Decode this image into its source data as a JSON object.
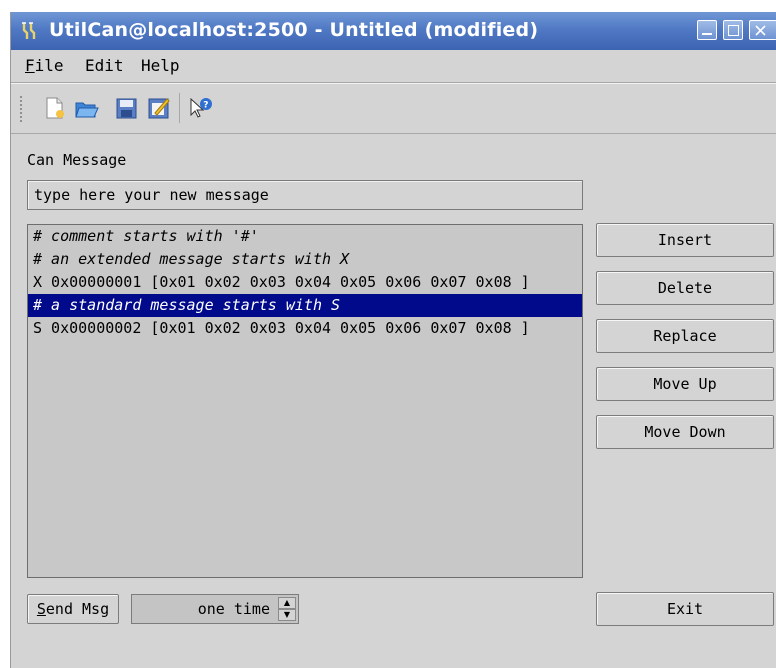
{
  "window": {
    "title": "UtilCan@localhost:2500 - Untitled (modified)"
  },
  "menu": [
    {
      "label": "File",
      "mnemonic": "F",
      "rest": "ile"
    },
    {
      "label": "Edit"
    },
    {
      "label": "Help"
    }
  ],
  "toolbar": {
    "icons": [
      "new-file-icon",
      "open-folder-icon",
      "save-icon",
      "edit-icon",
      "whats-this-help-icon"
    ]
  },
  "main": {
    "section_label": "Can Message",
    "message_input_value": "type here your new message",
    "messages": [
      {
        "text": "# comment starts with '#'",
        "kind": "comment"
      },
      {
        "text": "# an extended message starts with X",
        "kind": "comment"
      },
      {
        "text": "X 0x00000001 [0x01 0x02 0x03 0x04 0x05 0x06 0x07 0x08 ]",
        "kind": "message"
      },
      {
        "text": "# a standard message starts with S",
        "kind": "comment",
        "selected": true
      },
      {
        "text": "S 0x00000002 [0x01 0x02 0x03 0x04 0x05 0x06 0x07 0x08 ]",
        "kind": "message"
      }
    ]
  },
  "buttons": {
    "insert": "Insert",
    "delete": "Delete",
    "replace": "Replace",
    "move_up": "Move Up",
    "move_down": "Move Down",
    "exit": "Exit"
  },
  "send": {
    "label_mnemonic": "S",
    "label_rest": "end Msg",
    "repeat_value": "one time"
  },
  "colors": {
    "titlebar": "#4a72bf",
    "selection": "#000a8a",
    "window_bg": "#d4d4d4"
  }
}
